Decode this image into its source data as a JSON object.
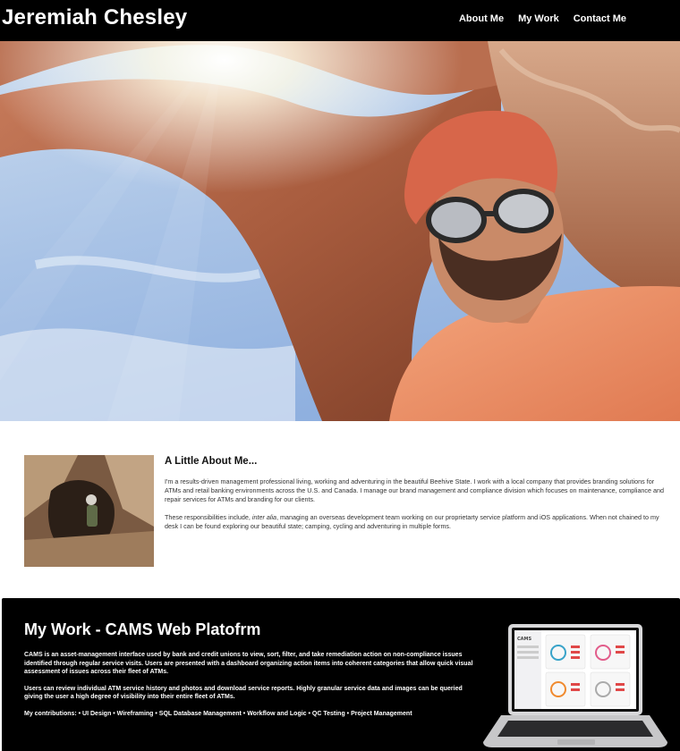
{
  "header": {
    "brand": "Jeremiah Chesley",
    "nav": [
      {
        "label": "About Me"
      },
      {
        "label": "My Work"
      },
      {
        "label": "Contact Me"
      }
    ]
  },
  "about": {
    "title": "A Little About Me...",
    "p1": "I'm a results-driven management professional living, working and adventuring in the beautiful Beehive State. I work with a local company that provides branding solutions for ATMs and retail banking environments across the U.S. and Canada. I manage our brand management and compliance division which focuses on maintenance, compliance and repair services for ATMs and branding for our clients.",
    "p2_before": "These responsibilities include, ",
    "p2_em": "inter alia",
    "p2_after": ", managing an overseas development team working on our proprietarty service platform and iOS applications. When not chained to my desk I can be found exploring our beautiful state; camping, cycling and adventuring in multiple forms."
  },
  "work": {
    "title": "My Work - CAMS Web Platofrm",
    "p1": "CAMS is an asset-management interface used by bank and credit unions to view, sort, filter, and take remediation action on non-compliance issues identified through regular service visits. Users are presented with a dashboard organizing action items into coherent categories that allow quick visual assessment of issues across their fleet of ATMs.",
    "p2": "Users can review individual ATM service history and photos and download service reports. Highly granular service data and images can be queried giving the user a high degree of visibility into their entire fleet of ATMs.",
    "contributions": "My contributions: • UI Design • Wireframing • SQL Database Management • Workflow and Logic • QC Testing • Project Management",
    "laptop_logo": "CAMS"
  }
}
